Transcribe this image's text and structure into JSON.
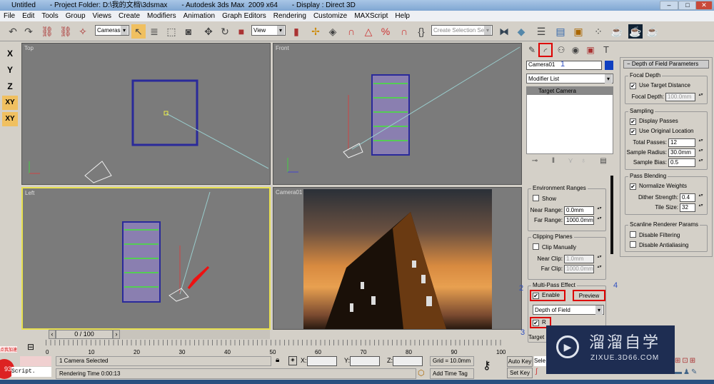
{
  "title_bar": {
    "doc": "Untitled",
    "project": "- Project Folder: D:\\我的文档\\3dsmax",
    "app": "- Autodesk 3ds Max  2009 x64",
    "display": "- Display : Direct 3D"
  },
  "menu": [
    "File",
    "Edit",
    "Tools",
    "Group",
    "Views",
    "Create",
    "Modifiers",
    "Animation",
    "Graph Editors",
    "Rendering",
    "Customize",
    "MAXScript",
    "Help"
  ],
  "toolbar": {
    "selection_filter": "Cameras",
    "ref_coord": "View",
    "selection_set_placeholder": "Create Selection Set"
  },
  "axis_buttons": [
    "X",
    "Y",
    "Z",
    "XY",
    "XY"
  ],
  "viewports": {
    "top": "Top",
    "front": "Front",
    "left": "Left",
    "camera": "Camera01"
  },
  "command_panel": {
    "object_name": "Camera01",
    "object_color": "#1040c0",
    "modifier_list": "Modifier List",
    "stack_item": "Target Camera",
    "env_ranges": {
      "title": "Environment Ranges",
      "show": "Show",
      "near_label": "Near Range:",
      "near": "0.0mm",
      "far_label": "Far Range:",
      "far": "1000.0mm"
    },
    "clipping": {
      "title": "Clipping Planes",
      "clip_manually": "Clip Manually",
      "near_label": "Near Clip:",
      "near": "1.0mm",
      "far_label": "Far Clip:",
      "far": "1000.0mm"
    },
    "multipass": {
      "title": "Multi-Pass Effect",
      "enable": "Enable",
      "preview": "Preview",
      "effect": "Depth of Field",
      "render_effect": "R"
    },
    "target_label": "Target"
  },
  "dof": {
    "title": "Depth of Field Parameters",
    "focal": {
      "title": "Focal Depth",
      "use_target": "Use Target Distance",
      "depth_label": "Focal Depth:",
      "depth": "100.0mm"
    },
    "sampling": {
      "title": "Sampling",
      "display_passes": "Display Passes",
      "use_original": "Use Original Location",
      "total_label": "Total Passes:",
      "total": "12",
      "radius_label": "Sample Radius:",
      "radius": "30.0mm",
      "bias_label": "Sample Bias:",
      "bias": "0.5"
    },
    "blending": {
      "title": "Pass Blending",
      "normalize": "Normalize Weights",
      "dither_label": "Dither Strength:",
      "dither": "0.4",
      "tile_label": "Tile Size:",
      "tile": "32"
    },
    "scanline": {
      "title": "Scanline Renderer Params",
      "disable_filtering": "Disable Filtering",
      "disable_aa": "Disable Antialiasing"
    }
  },
  "annotations": [
    "1",
    "2",
    "3",
    "4"
  ],
  "timeline": {
    "slider": "0 / 100",
    "ticks": [
      "0",
      "10",
      "20",
      "30",
      "40",
      "50",
      "60",
      "70",
      "80",
      "90",
      "100"
    ]
  },
  "status": {
    "selected": "1 Camera Selected",
    "rendering_time": "Rendering Time  0:00:13",
    "x_label": "X:",
    "y_label": "Y:",
    "z_label": "Z:",
    "grid": "Grid = 10.0mm",
    "add_time_tag": "Add Time Tag",
    "auto_key": "Auto Key",
    "set_key": "Set Key",
    "sel": "Sele",
    "script": "Script.",
    "badge": "93",
    "badge_top": "点我加速"
  },
  "watermark": {
    "brand": "溜溜自学",
    "url": "ZIXUE.3D66.COM"
  }
}
